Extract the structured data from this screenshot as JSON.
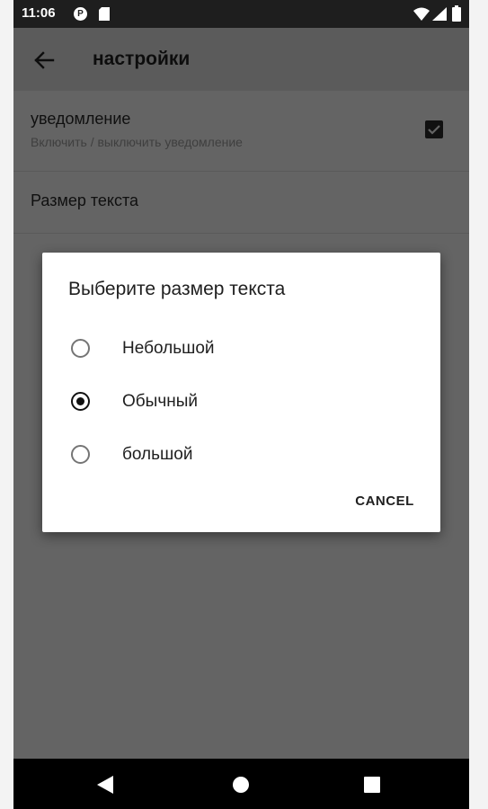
{
  "status_bar": {
    "time": "11:06",
    "badge_letter": "P"
  },
  "app_bar": {
    "title": "настройки"
  },
  "preferences": {
    "notification": {
      "title": "уведомление",
      "summary": "Включить / выключить уведомление",
      "checked": true
    },
    "text_size": {
      "title": "Размер текста"
    }
  },
  "dialog": {
    "title": "Выберите размер текста",
    "options": [
      {
        "label": "Небольшой",
        "selected": false
      },
      {
        "label": "Обычный",
        "selected": true
      },
      {
        "label": "большой",
        "selected": false
      }
    ],
    "cancel_label": "CANCEL"
  },
  "colors": {
    "status_bar": "#1e1e1e",
    "app_bar_dimmed": "#5b5b5b",
    "content_dimmed": "#646464",
    "dialog_bg": "#ffffff",
    "nav_bar": "#000000"
  }
}
